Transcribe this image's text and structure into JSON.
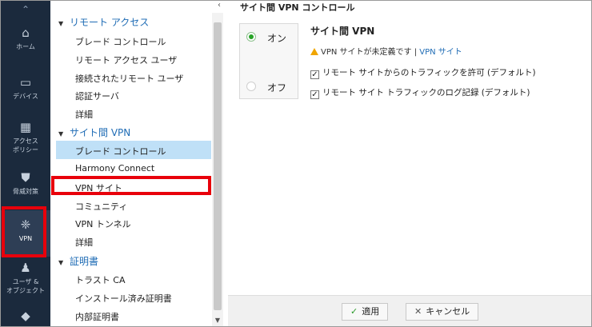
{
  "rail": {
    "up_icon": "chevron-up-icon",
    "items": [
      {
        "label": "ホーム",
        "icon": "home-icon"
      },
      {
        "label": "デバイス",
        "icon": "device-icon"
      },
      {
        "label": "アクセス\nポリシー",
        "label1": "アクセス",
        "label2": "ポリシー",
        "icon": "access-policy-icon"
      },
      {
        "label": "脅威対策",
        "icon": "shield-icon"
      },
      {
        "label": "VPN",
        "icon": "vpn-icon"
      },
      {
        "label1": "ユーザ &",
        "label2": "オブジェクト",
        "icon": "users-icon"
      }
    ]
  },
  "tree": {
    "groups": [
      {
        "label": "リモート アクセス",
        "items": [
          "ブレード コントロール",
          "リモート アクセス ユーザ",
          "接続されたリモート ユーザ",
          "認証サーバ",
          "詳細"
        ]
      },
      {
        "label": "サイト間 VPN",
        "items": [
          "ブレード コントロール",
          "Harmony Connect",
          "VPN サイト",
          "コミュニティ",
          "VPN トンネル",
          "詳細"
        ]
      },
      {
        "label": "証明書",
        "items": [
          "トラスト CA",
          "インストール済み証明書",
          "内部証明書"
        ]
      }
    ]
  },
  "main": {
    "title": "サイト間 VPN コントロール",
    "on_label": "オン",
    "off_label": "オフ",
    "section_title": "サイト間 VPN",
    "warning_text": "VPN サイトが未定義です | ",
    "warning_link": "VPN サイト",
    "check1": "リモート サイトからのトラフィックを許可 (デフォルト)",
    "check2": "リモート サイト トラフィックのログ記録 (デフォルト)",
    "apply": "適用",
    "cancel": "キャンセル"
  },
  "colors": {
    "accent": "#1f6cb5",
    "rail": "#1b2a3d",
    "selected": "#bfe0f7",
    "highlight": "#e8000b"
  }
}
